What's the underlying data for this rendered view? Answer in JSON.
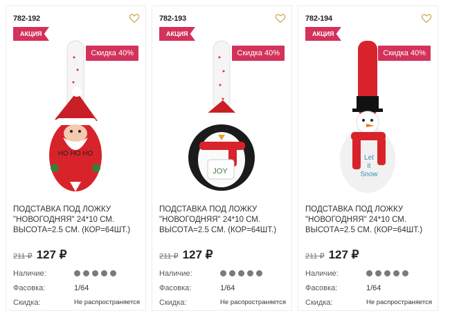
{
  "products": [
    {
      "sku": "782-192",
      "promo_label": "АКЦИЯ",
      "discount_label": "Скидка 40%",
      "title_lines": [
        "ПОДСТАВКА ПОД ЛОЖКУ",
        "\"НОВОГОДНЯЯ\" 24*10 СМ.",
        "ВЫСОТА=2.5 СМ. (КОР=64ШТ.)"
      ],
      "old_price": "211 ₽",
      "new_price": "127 ₽",
      "availability_label": "Наличие:",
      "availability_level": 5,
      "pack_label": "Фасовка:",
      "pack_value": "1/64",
      "discount_row_label": "Скидка:",
      "discount_row_value": "Не распространяется",
      "image": {
        "type": "santa",
        "icon": "santa-spoon-rest-image",
        "text": "HO HO HO"
      }
    },
    {
      "sku": "782-193",
      "promo_label": "АКЦИЯ",
      "discount_label": "Скидка 40%",
      "title_lines": [
        "ПОДСТАВКА ПОД ЛОЖКУ",
        "\"НОВОГОДНЯЯ\" 24*10 СМ.",
        "ВЫСОТА=2.5 СМ. (КОР=64ШТ.)"
      ],
      "old_price": "211 ₽",
      "new_price": "127 ₽",
      "availability_label": "Наличие:",
      "availability_level": 5,
      "pack_label": "Фасовка:",
      "pack_value": "1/64",
      "discount_row_label": "Скидка:",
      "discount_row_value": "Не распространяется",
      "image": {
        "type": "penguin",
        "icon": "penguin-spoon-rest-image",
        "text": "JOY"
      }
    },
    {
      "sku": "782-194",
      "promo_label": "АКЦИЯ",
      "discount_label": "Скидка 40%",
      "title_lines": [
        "ПОДСТАВКА ПОД ЛОЖКУ",
        "\"НОВОГОДНЯЯ\" 24*10 СМ.",
        "ВЫСОТА=2.5 СМ. (КОР=64ШТ.)"
      ],
      "old_price": "211 ₽",
      "new_price": "127 ₽",
      "availability_label": "Наличие:",
      "availability_level": 5,
      "pack_label": "Фасовка:",
      "pack_value": "1/64",
      "discount_row_label": "Скидка:",
      "discount_row_value": "Не распространяется",
      "image": {
        "type": "snowman",
        "icon": "snowman-spoon-rest-image",
        "text": "Let it Snow"
      }
    }
  ],
  "colors": {
    "accent": "#d3325b",
    "dot": "#7a7a7a",
    "heart": "#c9a24a"
  }
}
